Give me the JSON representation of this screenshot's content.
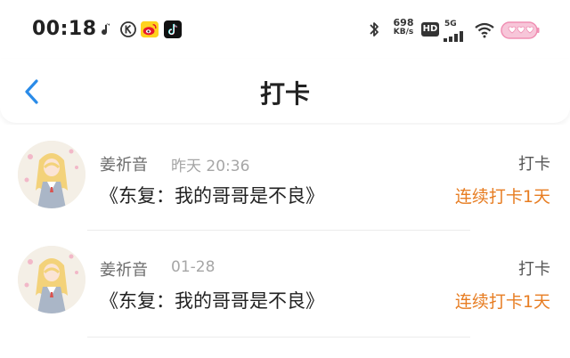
{
  "status_bar": {
    "time": "00:18",
    "net_speed": "698",
    "net_unit": "KB/s",
    "hd_label": "HD",
    "signal_label": "5G",
    "icons": [
      "music-note-icon",
      "k-circle-icon",
      "weibo-icon",
      "tiktok-icon",
      "bluetooth-icon",
      "wifi-icon",
      "battery-icon"
    ]
  },
  "header": {
    "title": "打卡",
    "back_icon": "chevron-left-icon"
  },
  "items": [
    {
      "name": "姜祈音",
      "time": "昨天 20:36",
      "book": "《东复：我的哥哥是不良》",
      "type": "打卡",
      "streak": "连续打卡1天"
    },
    {
      "name": "姜祈音",
      "time": "01-28",
      "book": "《东复：我的哥哥是不良》",
      "type": "打卡",
      "streak": "连续打卡1天"
    }
  ],
  "colors": {
    "accent_blue": "#2a8be8",
    "streak_orange": "#e77d22",
    "battery_pink": "#f08fb3"
  }
}
